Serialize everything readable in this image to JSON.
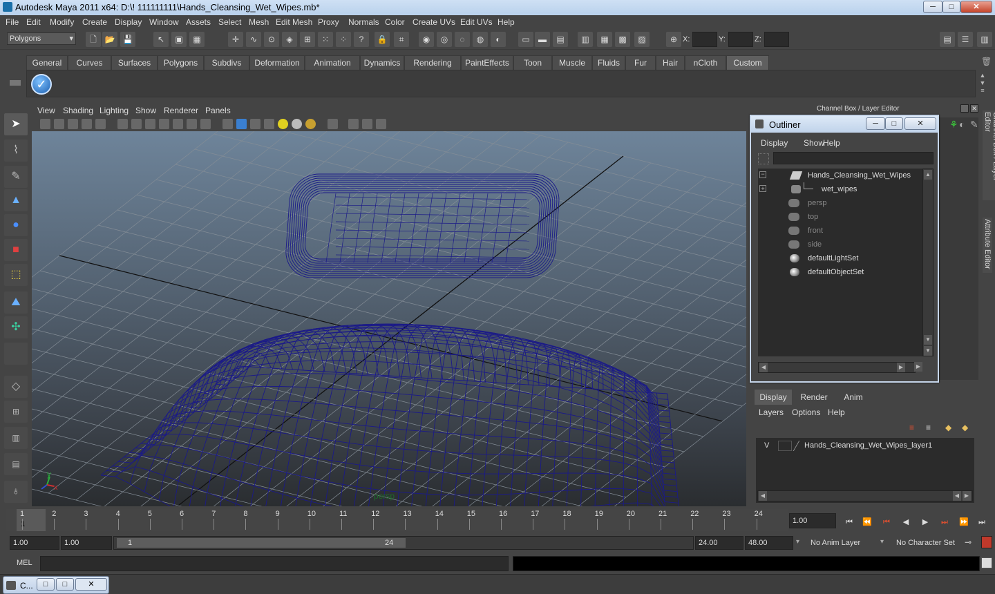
{
  "window": {
    "title": "Autodesk Maya 2011 x64: D:\\! 111111111\\Hands_Cleansing_Wet_Wipes.mb*",
    "min": "─",
    "max": "□",
    "close": "✕"
  },
  "menu": [
    "File",
    "Edit",
    "Modify",
    "Create",
    "Display",
    "Window",
    "Assets",
    "Select",
    "Mesh",
    "Edit Mesh",
    "Proxy",
    "Normals",
    "Color",
    "Create UVs",
    "Edit UVs",
    "Help"
  ],
  "status": {
    "mode_dropdown": "Polygons",
    "x_label": "X:",
    "y_label": "Y:",
    "z_label": "Z:"
  },
  "shelf_tabs": [
    "General",
    "Curves",
    "Surfaces",
    "Polygons",
    "Subdivs",
    "Deformation",
    "Animation",
    "Dynamics",
    "Rendering",
    "PaintEffects",
    "Toon",
    "Muscle",
    "Fluids",
    "Fur",
    "Hair",
    "nCloth",
    "Custom"
  ],
  "shelf_active_tab": "Custom",
  "viewport": {
    "menu": [
      "View",
      "Shading",
      "Lighting",
      "Show",
      "Renderer",
      "Panels"
    ],
    "camera_label": "persp",
    "axis_y": "y",
    "axis_x": "x",
    "wire_color": "#1b1a88"
  },
  "right_panel": {
    "title": "Channel Box / Layer Editor",
    "side_tab_1": "Channel Box / Layer Editor",
    "side_tab_2": "Attribute Editor"
  },
  "outliner": {
    "title": "Outliner",
    "menu": [
      "Display",
      "Show",
      "Help"
    ],
    "items": [
      {
        "label": "Hands_Cleansing_Wet_Wipes",
        "dim": false
      },
      {
        "label": "wet_wipes",
        "dim": false
      },
      {
        "label": "persp",
        "dim": true
      },
      {
        "label": "top",
        "dim": true
      },
      {
        "label": "front",
        "dim": true
      },
      {
        "label": "side",
        "dim": true
      },
      {
        "label": "defaultLightSet",
        "dim": false
      },
      {
        "label": "defaultObjectSet",
        "dim": false
      }
    ]
  },
  "layer_editor": {
    "tabs": [
      "Display",
      "Render",
      "Anim"
    ],
    "menu": [
      "Layers",
      "Options",
      "Help"
    ],
    "layer_visibility": "V",
    "layer_name": "Hands_Cleansing_Wet_Wipes_layer1"
  },
  "timeline": {
    "frames": [
      "1",
      "2",
      "3",
      "4",
      "5",
      "6",
      "7",
      "8",
      "9",
      "10",
      "11",
      "12",
      "13",
      "14",
      "15",
      "16",
      "17",
      "18",
      "19",
      "20",
      "21",
      "22",
      "23",
      "24"
    ],
    "current_frame_marker": "1",
    "current_time": "1.00"
  },
  "range": {
    "start": "1.00",
    "playback_start": "1.00",
    "slider_start": "1",
    "slider_end": "24",
    "playback_end": "24.00",
    "end": "48.00",
    "anim_layer": "No Anim Layer",
    "character_set": "No Character Set"
  },
  "command": {
    "label": "MEL"
  },
  "taskbar": {
    "label": "C..."
  }
}
